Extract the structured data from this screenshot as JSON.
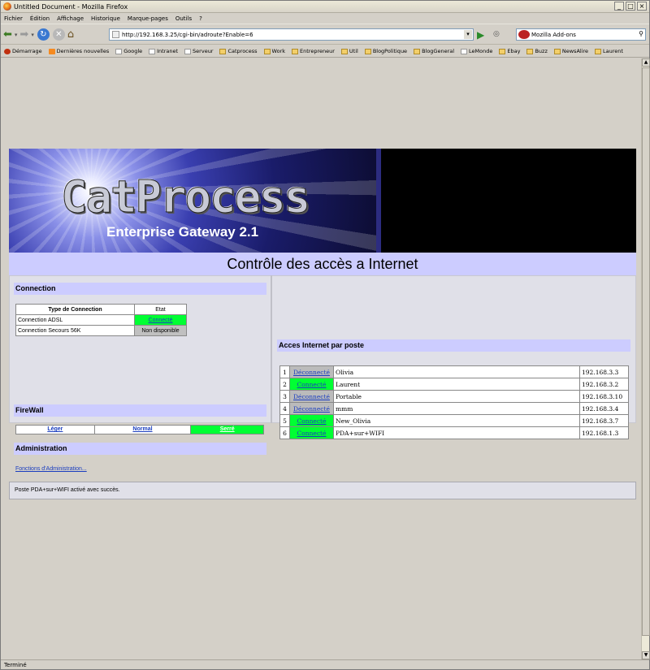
{
  "window": {
    "title": "Untitled Document - Mozilla Firefox",
    "buttons": [
      "_",
      "□",
      "×"
    ]
  },
  "menu": [
    "Fichier",
    "Édition",
    "Affichage",
    "Historique",
    "Marque-pages",
    "Outils",
    "?"
  ],
  "nav": {
    "url": "http://192.168.3.25/cgi-bin/adroute?Enable=6",
    "search_text": "Mozilla Add-ons"
  },
  "bookmarks": [
    {
      "label": "Démarrage",
      "icon": "firefox-icon"
    },
    {
      "label": "Dernières nouvelles",
      "icon": "rss-icon"
    },
    {
      "label": "Google",
      "icon": "page-icon"
    },
    {
      "label": "Intranet",
      "icon": "page-icon"
    },
    {
      "label": "Serveur",
      "icon": "page-icon"
    },
    {
      "label": "Catprocess",
      "icon": "folder-icon"
    },
    {
      "label": "Work",
      "icon": "folder-icon"
    },
    {
      "label": "Entrepreneur",
      "icon": "folder-icon"
    },
    {
      "label": "Util",
      "icon": "folder-icon"
    },
    {
      "label": "BlogPolitique",
      "icon": "folder-icon"
    },
    {
      "label": "BlogGeneral",
      "icon": "folder-icon"
    },
    {
      "label": "LeMonde",
      "icon": "page-icon"
    },
    {
      "label": "Ebay",
      "icon": "folder-icon"
    },
    {
      "label": "Buzz",
      "icon": "folder-icon"
    },
    {
      "label": "NewsAlire",
      "icon": "folder-icon"
    },
    {
      "label": "Laurent",
      "icon": "folder-icon"
    }
  ],
  "banner": {
    "logo": "CatProcess",
    "subtitle": "Enterprise Gateway 2.1"
  },
  "page": {
    "title": "Contrôle des accès a Internet"
  },
  "left": {
    "connection_heading": "Connection",
    "conn_table": {
      "headers": [
        "Type de Connection",
        "Etat"
      ],
      "rows": [
        {
          "type": "Connection ADSL",
          "state": "Connecté"
        },
        {
          "type": "Connection Secours 56K",
          "state": "Non disponible"
        }
      ]
    },
    "firewall_heading": "FireWall",
    "firewall": [
      "Léger",
      "Normal",
      "Serré"
    ],
    "admin_heading": "Administration",
    "admin_link": "Fonctions d'Administration..."
  },
  "right": {
    "heading": "Acces Internet par poste",
    "rows": [
      {
        "num": "1",
        "state": "Déconnecté",
        "name": "Olivia",
        "ip": "192.168.3.3"
      },
      {
        "num": "2",
        "state": "Connecté",
        "name": "Laurent",
        "ip": "192.168.3.2"
      },
      {
        "num": "3",
        "state": "Déconnecté",
        "name": "Portable",
        "ip": "192.168.3.10"
      },
      {
        "num": "4",
        "state": "Déconnecté",
        "name": "mmm",
        "ip": "192.168.3.4"
      },
      {
        "num": "5",
        "state": "Connecté",
        "name": "New_Olivia",
        "ip": "192.168.3.7"
      },
      {
        "num": "6",
        "state": "Connecté",
        "name": "PDA+sur+WIFI",
        "ip": "192.168.1.3"
      }
    ]
  },
  "message": "Poste PDA+sur+WIFI activé avec succès.",
  "status": "Terminé",
  "colors": {
    "connected": "#00ff33",
    "disconnected": "#bbbbbb",
    "header_bg": "#ccccff"
  }
}
